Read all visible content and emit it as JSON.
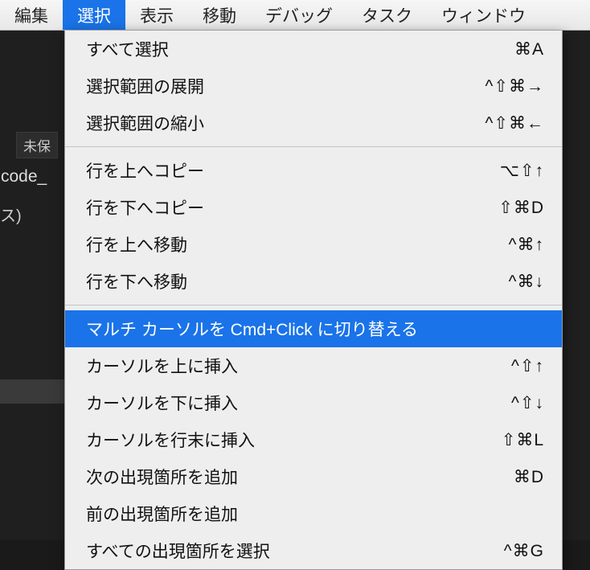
{
  "menubar": {
    "items": [
      {
        "label": "編集"
      },
      {
        "label": "選択",
        "active": true
      },
      {
        "label": "表示"
      },
      {
        "label": "移動"
      },
      {
        "label": "デバッグ"
      },
      {
        "label": "タスク"
      },
      {
        "label": "ウィンドウ"
      }
    ]
  },
  "background": {
    "tabLabel": "未保",
    "codeLabel": "code_",
    "parenLabel": "ス)"
  },
  "dropdown": {
    "groups": [
      [
        {
          "label": "すべて選択",
          "shortcut": "⌘A"
        },
        {
          "label": "選択範囲の展開",
          "shortcut": "^⇧⌘→"
        },
        {
          "label": "選択範囲の縮小",
          "shortcut": "^⇧⌘←"
        }
      ],
      [
        {
          "label": "行を上へコピー",
          "shortcut": "⌥⇧↑"
        },
        {
          "label": "行を下へコピー",
          "shortcut": "⇧⌘D"
        },
        {
          "label": "行を上へ移動",
          "shortcut": "^⌘↑"
        },
        {
          "label": "行を下へ移動",
          "shortcut": "^⌘↓"
        }
      ],
      [
        {
          "label": "マルチ カーソルを Cmd+Click に切り替える",
          "shortcut": "",
          "highlighted": true
        },
        {
          "label": "カーソルを上に挿入",
          "shortcut": "^⇧↑"
        },
        {
          "label": "カーソルを下に挿入",
          "shortcut": "^⇧↓"
        },
        {
          "label": "カーソルを行末に挿入",
          "shortcut": "⇧⌘L"
        },
        {
          "label": "次の出現箇所を追加",
          "shortcut": "⌘D"
        },
        {
          "label": "前の出現箇所を追加",
          "shortcut": ""
        },
        {
          "label": "すべての出現箇所を選択",
          "shortcut": "^⌘G"
        }
      ]
    ]
  }
}
